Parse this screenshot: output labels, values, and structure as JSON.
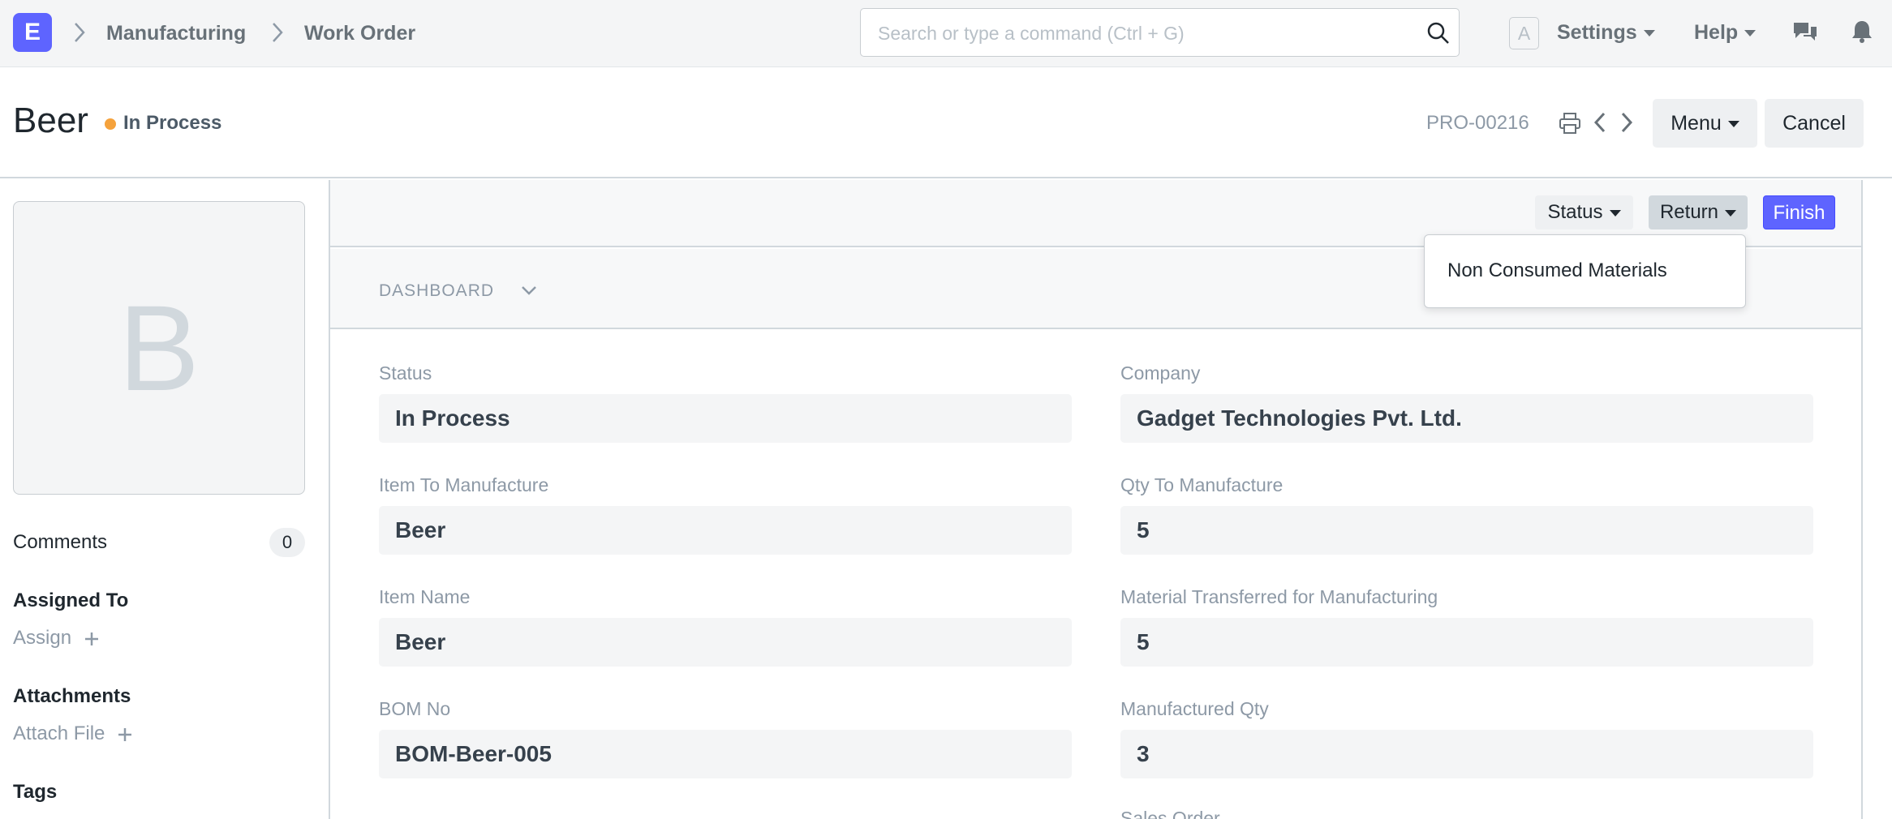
{
  "navbar": {
    "logo_letter": "E",
    "breadcrumbs": [
      "Manufacturing",
      "Work Order"
    ],
    "search_placeholder": "Search or type a command (Ctrl + G)",
    "avatar_letter": "A",
    "settings_label": "Settings",
    "help_label": "Help"
  },
  "page": {
    "title": "Beer",
    "status": "In Process",
    "status_color": "#f5a23c",
    "doc_name": "PRO-00216",
    "menu_label": "Menu",
    "cancel_label": "Cancel"
  },
  "sidebar": {
    "image_letter": "B",
    "comments_label": "Comments",
    "comments_count": "0",
    "assigned_to_label": "Assigned To",
    "assign_label": "Assign",
    "attachments_label": "Attachments",
    "attach_file_label": "Attach File",
    "tags_label": "Tags"
  },
  "toolbar": {
    "status_label": "Status",
    "return_label": "Return",
    "finish_label": "Finish",
    "accent_color": "#5e64ff"
  },
  "dropdown": {
    "items": [
      "Non Consumed Materials"
    ]
  },
  "dashboard": {
    "label": "DASHBOARD"
  },
  "fields": {
    "left": [
      {
        "label": "Status",
        "value": "In Process"
      },
      {
        "label": "Item To Manufacture",
        "value": "Beer"
      },
      {
        "label": "Item Name",
        "value": "Beer"
      },
      {
        "label": "BOM No",
        "value": "BOM-Beer-005"
      }
    ],
    "right": [
      {
        "label": "Company",
        "value": "Gadget Technologies Pvt. Ltd."
      },
      {
        "label": "Qty To Manufacture",
        "value": "5"
      },
      {
        "label": "Material Transferred for Manufacturing",
        "value": "5"
      },
      {
        "label": "Manufactured Qty",
        "value": "3"
      },
      {
        "label": "Sales Order",
        "value": ""
      }
    ]
  }
}
